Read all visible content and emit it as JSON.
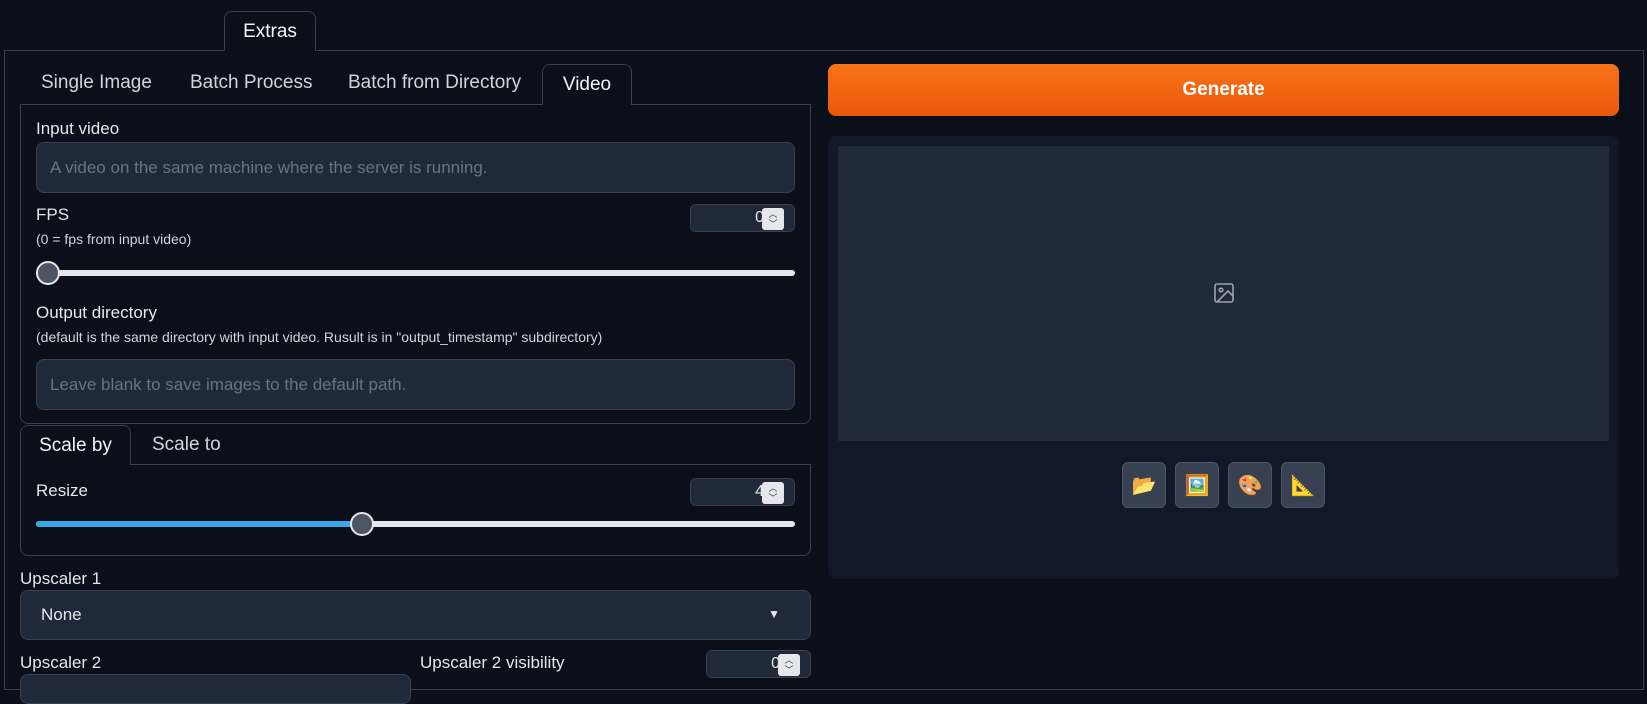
{
  "top_tab": {
    "label": "Extras"
  },
  "subtabs": [
    {
      "label": "Single Image"
    },
    {
      "label": "Batch Process"
    },
    {
      "label": "Batch from Directory"
    },
    {
      "label": "Video"
    }
  ],
  "input_video": {
    "label": "Input video",
    "placeholder": "A video on the same machine where the server is running."
  },
  "fps": {
    "label": "FPS",
    "note": "(0 = fps from input video)",
    "value": "0",
    "slider_fraction": 0
  },
  "output_directory": {
    "label": "Output directory",
    "note": "(default is the same directory with input video. Rusult is in \"output_timestamp\" subdirectory)",
    "placeholder": "Leave blank to save images to the default path."
  },
  "scale_tabs": [
    {
      "label": "Scale by"
    },
    {
      "label": "Scale to"
    }
  ],
  "resize": {
    "label": "Resize",
    "value": "4",
    "slider_fraction": 0.43
  },
  "upscaler1": {
    "label": "Upscaler 1",
    "value": "None"
  },
  "upscaler2": {
    "label": "Upscaler 2"
  },
  "upscaler2_visibility": {
    "label": "Upscaler 2 visibility",
    "value": "0"
  },
  "generate": {
    "label": "Generate"
  },
  "output_tools": [
    {
      "icon": "folder-icon",
      "glyph": "📂"
    },
    {
      "icon": "image-icon",
      "glyph": "🖼️"
    },
    {
      "icon": "palette-icon",
      "glyph": "🎨"
    },
    {
      "icon": "ruler-icon",
      "glyph": "📐"
    }
  ],
  "colors": {
    "accent": "#f97316",
    "slider_fill": "#3ba7e6"
  }
}
